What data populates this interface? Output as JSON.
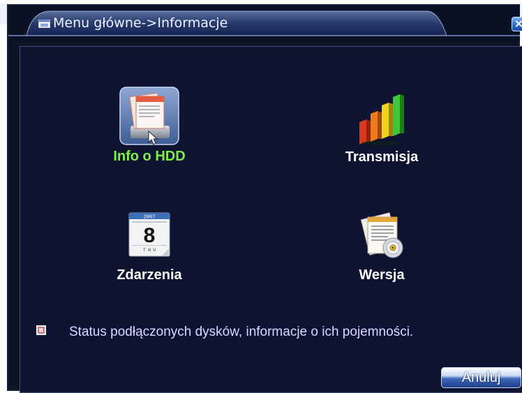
{
  "window": {
    "title": "Menu główne->Informacje",
    "close_label": "×"
  },
  "tiles": [
    {
      "label": "Info o HDD",
      "icon": "hdd-info-icon",
      "selected": true
    },
    {
      "label": "Transmisja",
      "icon": "bar-chart-icon",
      "selected": false
    },
    {
      "label": "Zdarzenia",
      "icon": "calendar-icon",
      "selected": false,
      "calendar": {
        "year": "2007",
        "day": "8",
        "weekday": "T H U"
      }
    },
    {
      "label": "Wersja",
      "icon": "version-document-icon",
      "selected": false
    }
  ],
  "status": {
    "icon": "status-bullet-icon",
    "text": "Status podłączonych dysków, informacje o ich pojemności."
  },
  "buttons": {
    "cancel_label": "Anuluj"
  },
  "colors": {
    "background": "#0d1330",
    "selected_label": "#7ef04a",
    "label": "#ffffff",
    "status_text": "#d6dcff"
  }
}
